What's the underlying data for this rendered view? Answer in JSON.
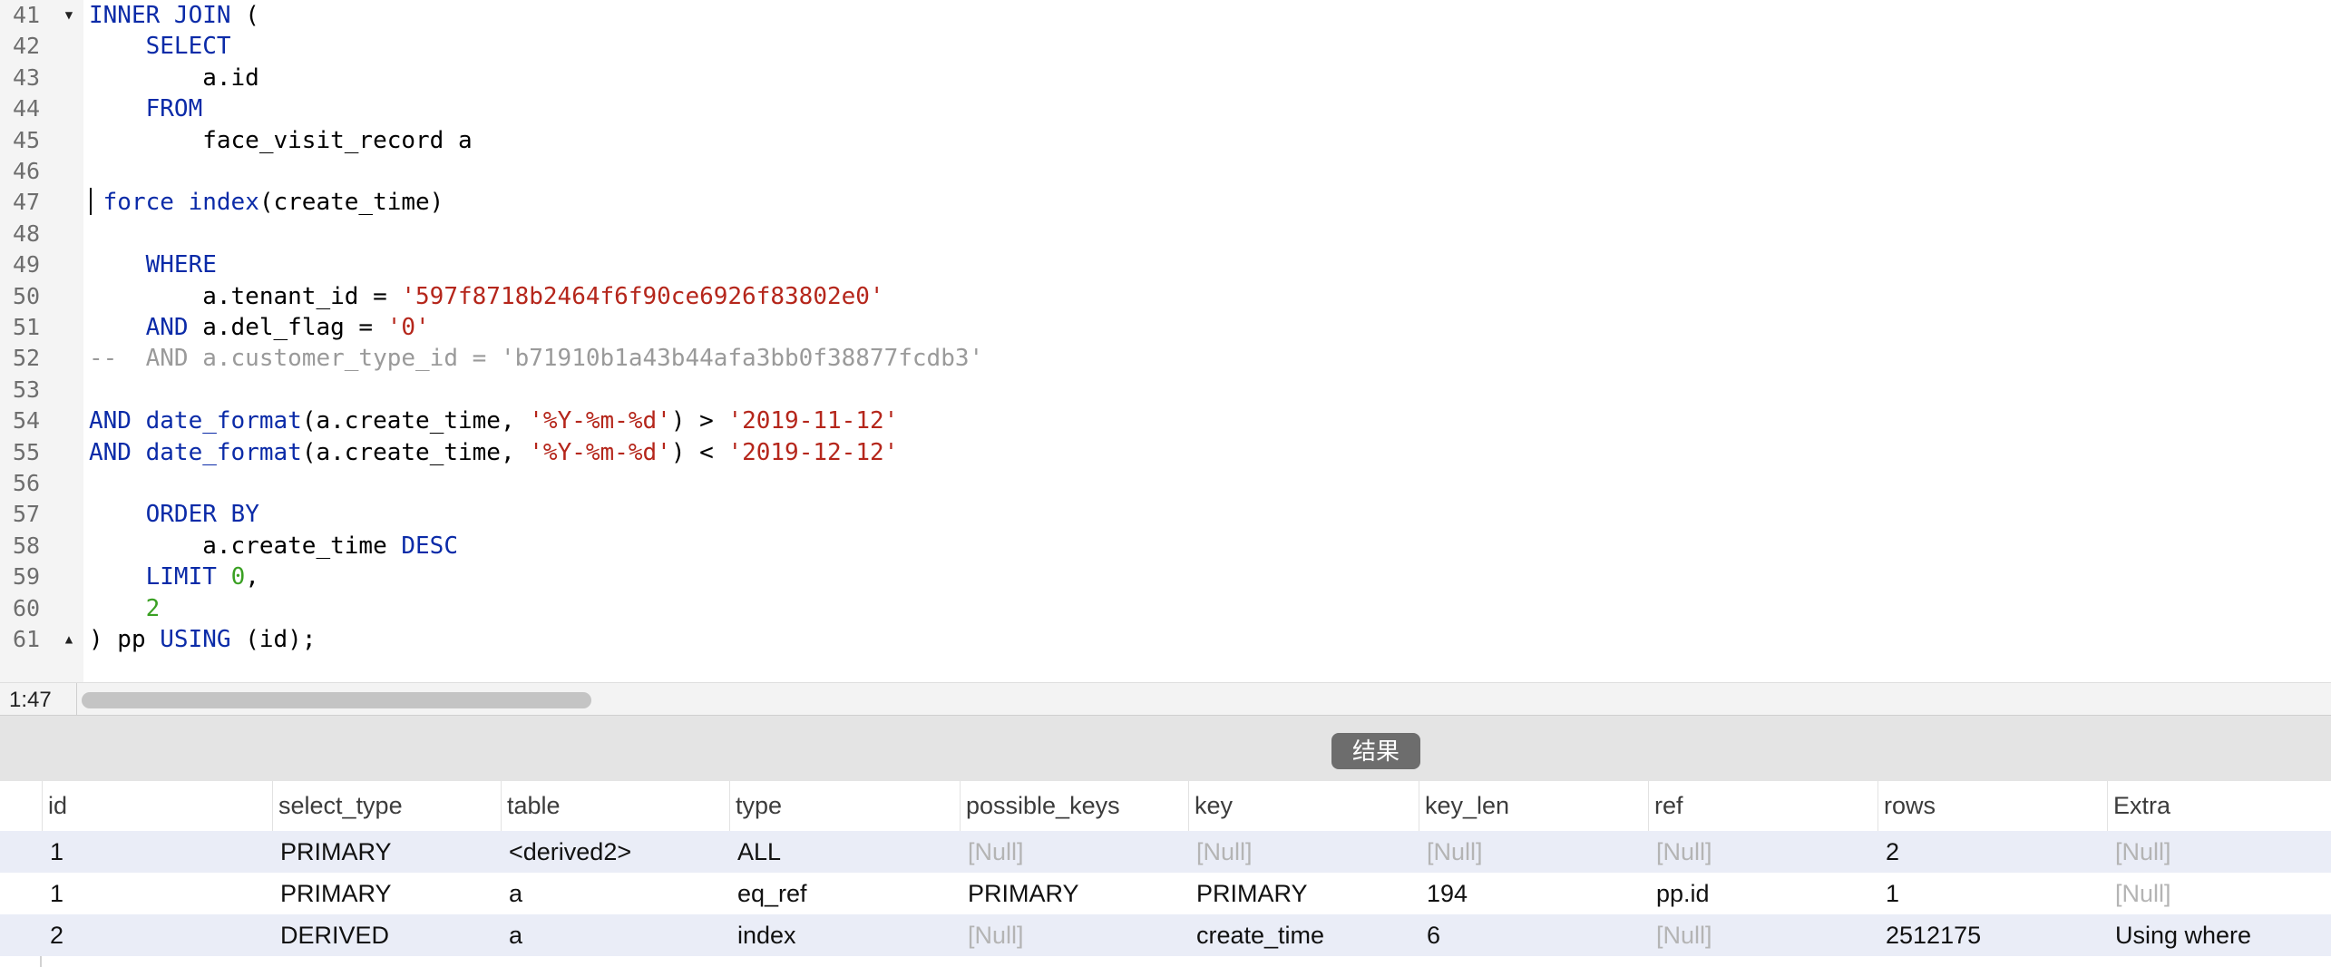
{
  "editor": {
    "lines": [
      {
        "n": "41",
        "fold": "▼",
        "tokens": [
          [
            "kw",
            "INNER JOIN"
          ],
          [
            "plain",
            " ("
          ]
        ]
      },
      {
        "n": "42",
        "fold": "",
        "tokens": [
          [
            "plain",
            "    "
          ],
          [
            "kw",
            "SELECT"
          ]
        ]
      },
      {
        "n": "43",
        "fold": "",
        "tokens": [
          [
            "plain",
            "        a.id"
          ]
        ]
      },
      {
        "n": "44",
        "fold": "",
        "tokens": [
          [
            "plain",
            "    "
          ],
          [
            "kw",
            "FROM"
          ]
        ]
      },
      {
        "n": "45",
        "fold": "",
        "tokens": [
          [
            "plain",
            "        face_visit_record a"
          ]
        ]
      },
      {
        "n": "46",
        "fold": "",
        "tokens": []
      },
      {
        "n": "47",
        "fold": "",
        "tokens": [
          [
            "plain",
            " "
          ],
          [
            "kw",
            "force index"
          ],
          [
            "plain",
            "(create_time)"
          ]
        ]
      },
      {
        "n": "48",
        "fold": "",
        "tokens": []
      },
      {
        "n": "49",
        "fold": "",
        "tokens": [
          [
            "plain",
            "    "
          ],
          [
            "kw",
            "WHERE"
          ]
        ]
      },
      {
        "n": "50",
        "fold": "",
        "tokens": [
          [
            "plain",
            "        a.tenant_id = "
          ],
          [
            "str",
            "'597f8718b2464f6f90ce6926f83802e0'"
          ]
        ]
      },
      {
        "n": "51",
        "fold": "",
        "tokens": [
          [
            "plain",
            "    "
          ],
          [
            "kw",
            "AND"
          ],
          [
            "plain",
            " a.del_flag = "
          ],
          [
            "str",
            "'0'"
          ]
        ]
      },
      {
        "n": "52",
        "fold": "",
        "tokens": [
          [
            "cmt",
            "--  AND a.customer_type_id = 'b71910b1a43b44afa3bb0f38877fcdb3'"
          ]
        ]
      },
      {
        "n": "53",
        "fold": "",
        "tokens": []
      },
      {
        "n": "54",
        "fold": "",
        "tokens": [
          [
            "kw",
            "AND"
          ],
          [
            "plain",
            " "
          ],
          [
            "fn",
            "date_format"
          ],
          [
            "plain",
            "(a.create_time, "
          ],
          [
            "str",
            "'%Y-%m-%d'"
          ],
          [
            "plain",
            ") > "
          ],
          [
            "str",
            "'2019-11-12'"
          ]
        ]
      },
      {
        "n": "55",
        "fold": "",
        "tokens": [
          [
            "kw",
            "AND"
          ],
          [
            "plain",
            " "
          ],
          [
            "fn",
            "date_format"
          ],
          [
            "plain",
            "(a.create_time, "
          ],
          [
            "str",
            "'%Y-%m-%d'"
          ],
          [
            "plain",
            ") < "
          ],
          [
            "str",
            "'2019-12-12'"
          ]
        ]
      },
      {
        "n": "56",
        "fold": "",
        "tokens": []
      },
      {
        "n": "57",
        "fold": "",
        "tokens": [
          [
            "plain",
            "    "
          ],
          [
            "kw",
            "ORDER BY"
          ]
        ]
      },
      {
        "n": "58",
        "fold": "",
        "tokens": [
          [
            "plain",
            "        a.create_time "
          ],
          [
            "kw",
            "DESC"
          ]
        ]
      },
      {
        "n": "59",
        "fold": "",
        "tokens": [
          [
            "plain",
            "    "
          ],
          [
            "kw",
            "LIMIT"
          ],
          [
            "plain",
            " "
          ],
          [
            "num",
            "0"
          ],
          [
            "plain",
            ","
          ]
        ]
      },
      {
        "n": "60",
        "fold": "",
        "tokens": [
          [
            "plain",
            "    "
          ],
          [
            "num",
            "2"
          ]
        ]
      },
      {
        "n": "61",
        "fold": "▲",
        "tokens": [
          [
            "plain",
            ") pp "
          ],
          [
            "kw",
            "USING"
          ],
          [
            "plain",
            " (id);"
          ]
        ]
      }
    ],
    "colors": {
      "keyword": "#0b2ba8",
      "string": "#b5261b",
      "number": "#3aa023",
      "comment": "#9a9a9a"
    }
  },
  "status": {
    "cursor_position": "1:47"
  },
  "results": {
    "tab_label": "结果",
    "columns": [
      "id",
      "select_type",
      "table",
      "type",
      "possible_keys",
      "key",
      "key_len",
      "ref",
      "rows",
      "Extra"
    ],
    "rows": [
      [
        "1",
        "PRIMARY",
        "<derived2>",
        "ALL",
        "[Null]",
        "[Null]",
        "[Null]",
        "[Null]",
        "2",
        "[Null]"
      ],
      [
        "1",
        "PRIMARY",
        "a",
        "eq_ref",
        "PRIMARY",
        "PRIMARY",
        "194",
        "pp.id",
        "1",
        "[Null]"
      ],
      [
        "2",
        "DERIVED",
        "a",
        "index",
        "[Null]",
        "create_time",
        "6",
        "[Null]",
        "2512175",
        "Using where"
      ]
    ],
    "null_text": "[Null]"
  }
}
